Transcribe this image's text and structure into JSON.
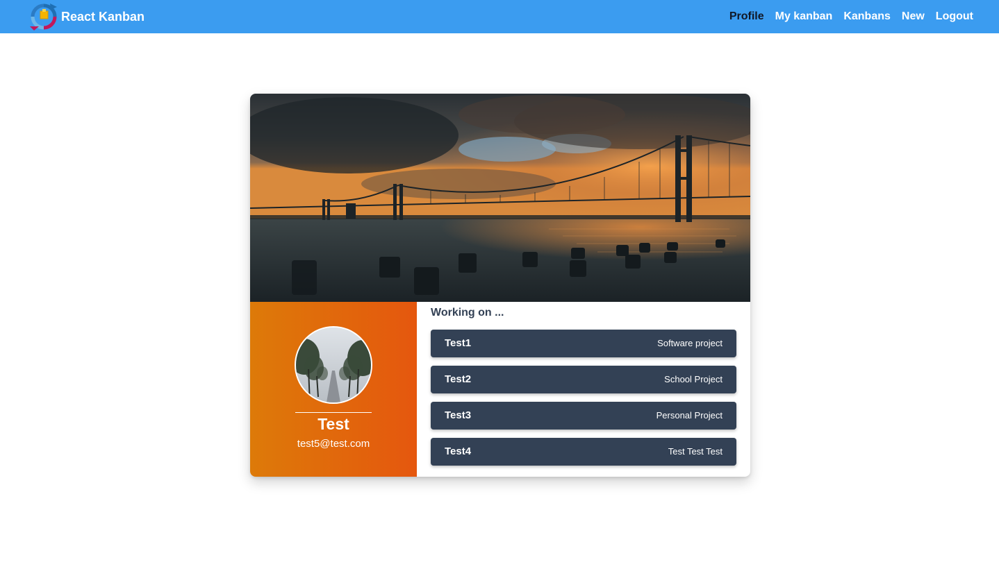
{
  "app": {
    "title": "React Kanban",
    "logo_icon": "recycle-arrows-box-icon"
  },
  "nav": {
    "items": [
      {
        "label": "Profile",
        "active": true
      },
      {
        "label": "My kanban",
        "active": false
      },
      {
        "label": "Kanbans",
        "active": false
      },
      {
        "label": "New",
        "active": false
      },
      {
        "label": "Logout",
        "active": false
      }
    ]
  },
  "profile": {
    "cover_image": "bay-bridge-sunset-photo",
    "avatar_image": "foggy-tree-lined-road-photo",
    "name": "Test",
    "email": "test5@test.com"
  },
  "projects": {
    "heading": "Working on ...",
    "items": [
      {
        "name": "Test1",
        "description": "Software project"
      },
      {
        "name": "Test2",
        "description": "School Project"
      },
      {
        "name": "Test3",
        "description": "Personal Project"
      },
      {
        "name": "Test4",
        "description": "Test Test Test"
      }
    ]
  },
  "colors": {
    "navbar": "#3b9cf0",
    "active_nav": "#111827",
    "sidebar_gradient_start": "#dd7a09",
    "sidebar_gradient_end": "#e5570e",
    "project_item_bg": "#334155"
  }
}
